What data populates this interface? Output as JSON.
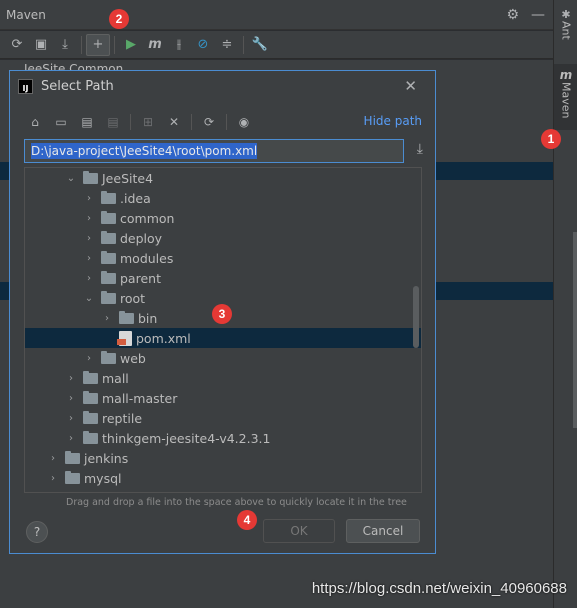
{
  "tool_window": {
    "title": "Maven",
    "peek_text": "JeeSite Common"
  },
  "side_tabs": {
    "ant": "Ant",
    "maven": "Maven"
  },
  "callouts": [
    "1",
    "2",
    "3",
    "4"
  ],
  "dialog": {
    "title": "Select Path",
    "hide_path_label": "Hide path",
    "path_value": "D:\\java-project\\JeeSite4\\root\\pom.xml",
    "tree": [
      {
        "label": "JeeSite4",
        "expanded": true
      },
      {
        "label": ".idea"
      },
      {
        "label": "common"
      },
      {
        "label": "deploy"
      },
      {
        "label": "modules"
      },
      {
        "label": "parent"
      },
      {
        "label": "root",
        "expanded": true
      },
      {
        "label": "bin"
      },
      {
        "label": "pom.xml",
        "selected": true
      },
      {
        "label": "web"
      },
      {
        "label": "mall"
      },
      {
        "label": "mall-master"
      },
      {
        "label": "reptile"
      },
      {
        "label": "thinkgem-jeesite4-v4.2.3.1"
      },
      {
        "label": "jenkins"
      },
      {
        "label": "mysql"
      }
    ],
    "hint": "Drag and drop a file into the space above to quickly locate it in the tree",
    "help_label": "?",
    "ok_label": "OK",
    "cancel_label": "Cancel"
  },
  "watermark": "https://blog.csdn.net/weixin_40960688",
  "colors": {
    "accent": "#4b8cd1",
    "selection": "#0d293e",
    "link": "#589df6",
    "callout": "#e53935"
  }
}
